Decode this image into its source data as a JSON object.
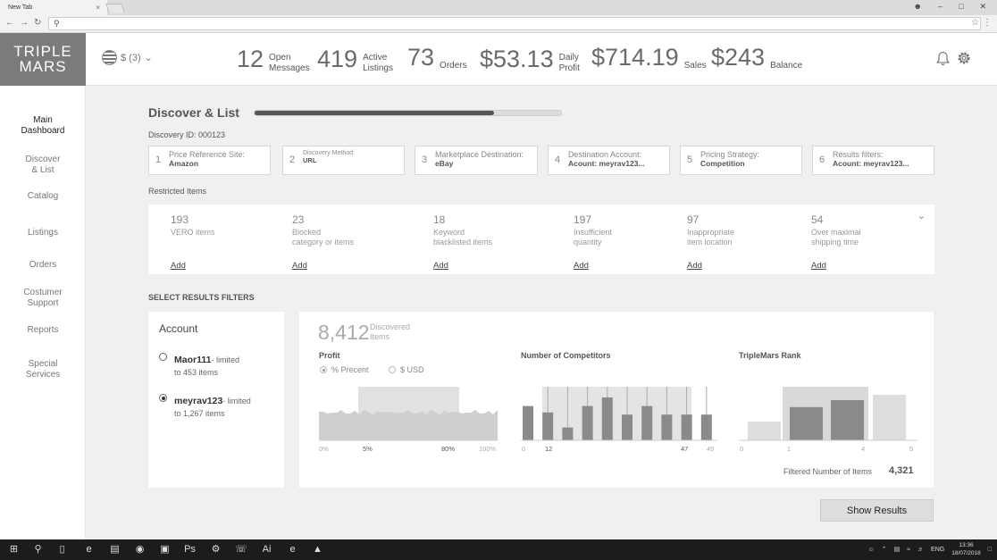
{
  "browser": {
    "tab_title": "New Tab",
    "tab_close": "×",
    "address": "",
    "search_glyph": "⚲"
  },
  "topbar": {
    "logo_line1": "TRIPLE",
    "logo_line2": "MARS",
    "currency": "$ (3)",
    "kpis": [
      {
        "value": "12",
        "label1": "Open",
        "label2": "Messages"
      },
      {
        "value": "419",
        "label1": "Active",
        "label2": "Listings"
      },
      {
        "value": "73",
        "label1": "Orders",
        "label2": ""
      },
      {
        "value": "$53.13",
        "label1": "Daily",
        "label2": "Profit"
      },
      {
        "value": "$714.19",
        "label1": "Sales",
        "label2": ""
      },
      {
        "value": "$243",
        "label1": "Balance",
        "label2": ""
      }
    ]
  },
  "sidebar": {
    "items": [
      {
        "line1": "Main",
        "line2": "Dashboard"
      },
      {
        "line1": "Discover",
        "line2": "& List"
      },
      {
        "line1": "Catalog",
        "line2": ""
      },
      {
        "line1": "Listings",
        "line2": ""
      },
      {
        "line1": "Orders",
        "line2": ""
      },
      {
        "line1": "Costumer",
        "line2": "Support"
      },
      {
        "line1": "Reports",
        "line2": ""
      },
      {
        "line1": "Special",
        "line2": "Services"
      }
    ]
  },
  "page": {
    "title": "Discover & List",
    "progress": 0.78,
    "discovery_id": "Discovery ID: 000123",
    "steps": [
      {
        "index": "1",
        "title": "Price Reference Site:",
        "value": "Amazon"
      },
      {
        "index": "2",
        "title": "Discovery Method:",
        "value": "URL"
      },
      {
        "index": "3",
        "title": "Marketplace Destination:",
        "value": "eBay"
      },
      {
        "index": "4",
        "title": "Destination Account:",
        "value": "Acount: meyrav123..."
      },
      {
        "index": "5",
        "title": "Pricing Strategy:",
        "value": "Competition"
      },
      {
        "index": "6",
        "title": "Results filters:",
        "value": "Acount: meyrav123..."
      }
    ],
    "restricted_label": "Restricted Items",
    "restricted": [
      {
        "count": "193",
        "line1": "VERO items",
        "line2": "",
        "action": "Add"
      },
      {
        "count": "23",
        "line1": "Blocked",
        "line2": "category or items",
        "action": "Add"
      },
      {
        "count": "18",
        "line1": "Keyword",
        "line2": "blacklisted items",
        "action": "Add"
      },
      {
        "count": "197",
        "line1": "Insufficient",
        "line2": "quantity",
        "action": "Add"
      },
      {
        "count": "97",
        "line1": "Inappropriate",
        "line2": "item location",
        "action": "Add"
      },
      {
        "count": "54",
        "line1": "Over maximal",
        "line2": "shipping time",
        "action": "Add"
      }
    ],
    "filters_label": "SELECT RESULTS FILTERS",
    "account": {
      "title": "Account",
      "options": [
        {
          "name": "Maor111",
          "limit": "- limited",
          "items": "to 453 items",
          "selected": false
        },
        {
          "name": "meyrav123",
          "limit": "- limited",
          "items": "to 1,267 items",
          "selected": true
        }
      ]
    },
    "stats": {
      "discovered_count": "8,412",
      "discovered_line1": "Discovered",
      "discovered_line2": "Items",
      "profit_title": "Profit",
      "profit_options": [
        "% Precent",
        "$ USD"
      ],
      "profit_ticks": [
        "0%",
        "5%",
        "80%",
        "100%"
      ],
      "competitors_title": "Number of Competitors",
      "competitors_ticks": [
        "0",
        "12",
        "47",
        "49"
      ],
      "rank_title": "TripleMars Rank",
      "rank_ticks": [
        "0",
        "1",
        "4",
        "5"
      ],
      "filtered_label": "Filtered Number of Items",
      "filtered_value": "4,321"
    },
    "show_results": "Show Results"
  },
  "chart_data": [
    {
      "type": "area",
      "title": "Profit",
      "x_range": [
        "0%",
        "100%"
      ],
      "selected_range": [
        "5%",
        "80%"
      ]
    },
    {
      "type": "bar",
      "title": "Number of Competitors",
      "values": [
        0.8,
        0.65,
        0.3,
        0.8,
        1.0,
        0.6,
        0.8,
        0.6,
        0.6,
        0.6,
        0.3
      ],
      "selected_range": [
        12,
        47
      ],
      "x_ticks": [
        0,
        12,
        47,
        49
      ]
    },
    {
      "type": "bar",
      "title": "TripleMars Rank",
      "values": [
        0.35,
        0.62,
        0.75,
        0.85
      ],
      "selected_range": [
        1,
        4
      ],
      "x_ticks": [
        0,
        1,
        4,
        5
      ]
    }
  ],
  "taskbar": {
    "lang": "ENG",
    "time": "13:36",
    "date": "18/07/2018"
  },
  "colors": {
    "logo_bg": "#7b7b7b",
    "progress_fill": "#555555",
    "selected_band": "#d9d9d9",
    "bar_dark": "#8a8a8a",
    "bar_light": "#dddddd"
  }
}
